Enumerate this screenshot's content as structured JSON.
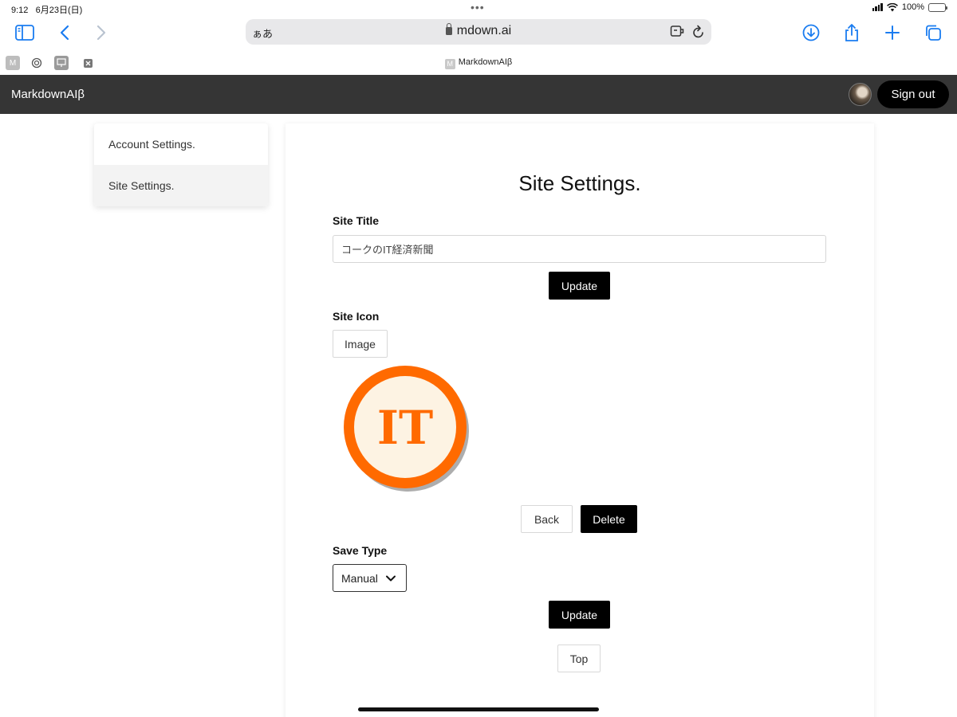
{
  "status_bar": {
    "time": "9:12",
    "date": "6月23日(日)",
    "battery": "100%"
  },
  "browser": {
    "url_aa": "ぁあ",
    "url": "mdown.ai",
    "tab_active_title": "MarkdownAIβ",
    "tab_favicon_letter": "M"
  },
  "app": {
    "brand": "MarkdownAIβ",
    "signout_label": "Sign out"
  },
  "sidebar": {
    "items": [
      {
        "label": "Account Settings.",
        "active": false
      },
      {
        "label": "Site Settings.",
        "active": true
      }
    ]
  },
  "main": {
    "title": "Site Settings.",
    "site_title_label": "Site Title",
    "site_title_value": "コークのIT経済新聞",
    "update_label_1": "Update",
    "site_icon_label": "Site Icon",
    "image_button_label": "Image",
    "icon_text": "IT",
    "back_label": "Back",
    "delete_label": "Delete",
    "save_type_label": "Save Type",
    "save_type_selected": "Manual",
    "update_label_2": "Update",
    "top_label": "Top"
  },
  "colors": {
    "header_bg": "#353535",
    "accent_blue": "#1a7cf0",
    "icon_orange": "#ff6a00"
  }
}
